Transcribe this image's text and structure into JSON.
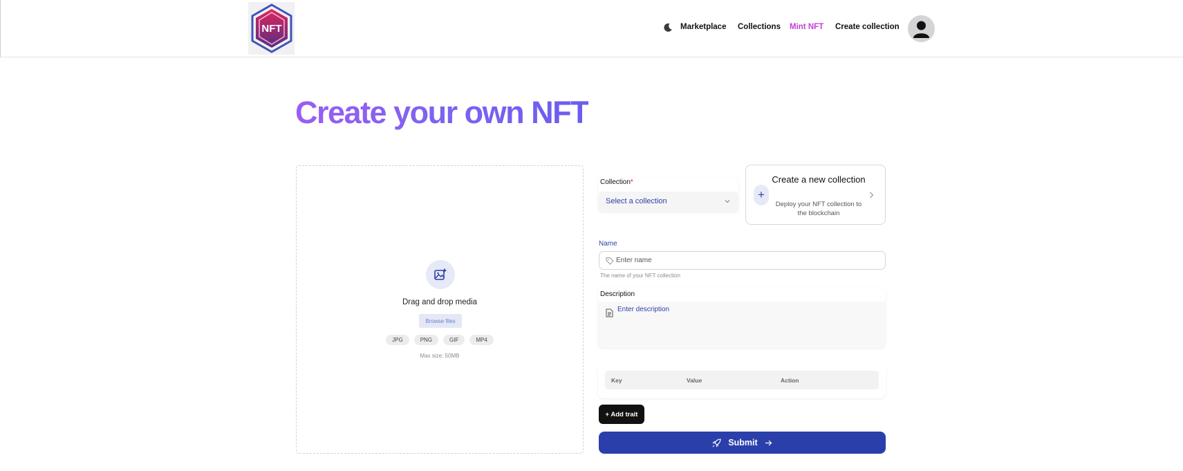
{
  "header": {
    "logo_text": "NFT",
    "nav": {
      "marketplace": "Marketplace",
      "collections": "Collections",
      "mint_nft": "Mint NFT",
      "create_collection": "Create collection"
    },
    "active_nav": "Mint NFT",
    "theme_icon": "moon-icon",
    "avatar_icon": "user-icon"
  },
  "page": {
    "title": "Create your own NFT"
  },
  "dropzone": {
    "icon": "image-plus-icon",
    "text": "Drag and drop media",
    "browse_label": "Browse files",
    "formats": [
      "JPG",
      "PNG",
      "GIF",
      "MP4"
    ],
    "max_size": "Max size: 50MB"
  },
  "collection": {
    "label": "Collection",
    "required_marker": "*",
    "placeholder": "Select a collection"
  },
  "new_collection": {
    "title": "Create a new collection",
    "subtitle": "Deploy your NFT collection to the blockchain"
  },
  "name_field": {
    "label": "Name",
    "placeholder": "Enter name",
    "help": "The name of your NFT collection"
  },
  "description_field": {
    "label": "Description",
    "placeholder": "Enter description"
  },
  "traits": {
    "columns": [
      "Key",
      "Value",
      "Action"
    ],
    "add_label": "+ Add trait"
  },
  "submit_label": "Submit",
  "colors": {
    "accent": "#2b3fab",
    "active_nav": "#c23fd4",
    "title_gradient_start": "#9a5df2",
    "title_gradient_end": "#6a5cf0"
  }
}
